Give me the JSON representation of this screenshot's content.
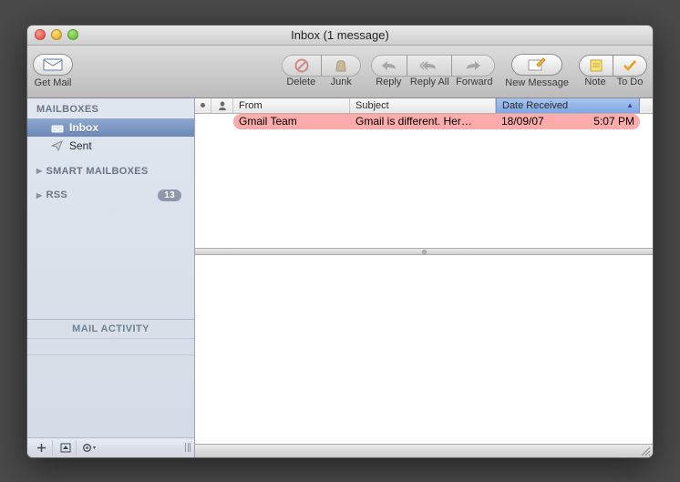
{
  "window": {
    "title": "Inbox (1 message)"
  },
  "toolbar": {
    "get_mail": "Get Mail",
    "delete": "Delete",
    "junk": "Junk",
    "reply": "Reply",
    "reply_all": "Reply All",
    "forward": "Forward",
    "new_message": "New Message",
    "note": "Note",
    "to_do": "To Do"
  },
  "sidebar": {
    "mailboxes_header": "MAILBOXES",
    "items": [
      {
        "label": "Inbox"
      },
      {
        "label": "Sent"
      }
    ],
    "smart_header": "SMART MAILBOXES",
    "rss_header": "RSS",
    "rss_badge": "13",
    "activity_header": "MAIL ACTIVITY"
  },
  "columns": {
    "from": "From",
    "subject": "Subject",
    "date": "Date Received"
  },
  "messages": [
    {
      "from": "Gmail Team",
      "subject": "Gmail is different. Her…",
      "date": "18/09/07",
      "time": "5:07 PM"
    }
  ]
}
